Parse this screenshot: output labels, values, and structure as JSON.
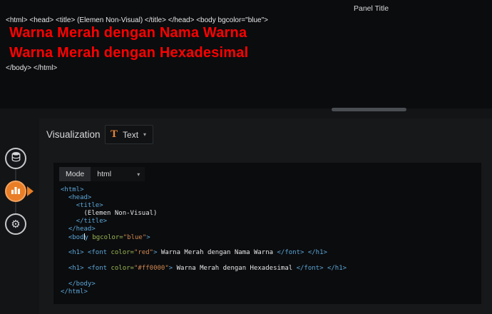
{
  "preview": {
    "panel_title": "Panel Title",
    "raw_top": "<html> <head> <title> (Elemen Non-Visual) </title> </head> <body bgcolor=\"blue\">",
    "heading1": "Warna Merah dengan Nama Warna",
    "heading2": "Warna Merah dengan Hexadesimal",
    "raw_bottom": "</body> </html>",
    "heading_color": "#ff0000"
  },
  "icons": {
    "viz_type_glyph": "T",
    "chevron": "▾",
    "gear": "⚙"
  },
  "rail": {
    "items": [
      {
        "label": "queries",
        "icon": "database-icon",
        "active": false
      },
      {
        "label": "visualization",
        "icon": "chart-icon",
        "active": true
      },
      {
        "label": "general",
        "icon": "gear-icon",
        "active": false
      }
    ]
  },
  "editor": {
    "section_label": "Visualization",
    "viz_type": "Text",
    "mode_label": "Mode",
    "mode_value": "html",
    "colors": {
      "tag": "#5ca7d8",
      "attr": "#9cb853",
      "str": "#d08850",
      "text": "#e6e6e6"
    },
    "code_lines": [
      [
        [
          "tag",
          "<html>"
        ]
      ],
      [
        [
          "text",
          "  "
        ],
        [
          "tag",
          "<head>"
        ]
      ],
      [
        [
          "text",
          "    "
        ],
        [
          "tag",
          "<title>"
        ]
      ],
      [
        [
          "text",
          "      (Elemen Non-Visual)"
        ]
      ],
      [
        [
          "text",
          "    "
        ],
        [
          "tag",
          "</title>"
        ]
      ],
      [
        [
          "text",
          "  "
        ],
        [
          "tag",
          "</head>"
        ]
      ],
      [
        [
          "text",
          "  "
        ],
        [
          "tag",
          "<bod"
        ],
        [
          "cursor",
          ""
        ],
        [
          "tag",
          "y "
        ],
        [
          "attr",
          "bgcolor="
        ],
        [
          "str",
          "\"blue\""
        ],
        [
          "tag",
          ">"
        ]
      ],
      [],
      [
        [
          "text",
          "  "
        ],
        [
          "tag",
          "<h1>"
        ],
        [
          "text",
          " "
        ],
        [
          "tag",
          "<font "
        ],
        [
          "attr",
          "color="
        ],
        [
          "str",
          "\"red\""
        ],
        [
          "tag",
          ">"
        ],
        [
          "text",
          " Warna Merah dengan Nama Warna "
        ],
        [
          "tag",
          "</font>"
        ],
        [
          "text",
          " "
        ],
        [
          "tag",
          "</h1>"
        ]
      ],
      [],
      [
        [
          "text",
          "  "
        ],
        [
          "tag",
          "<h1>"
        ],
        [
          "text",
          " "
        ],
        [
          "tag",
          "<font "
        ],
        [
          "attr",
          "color="
        ],
        [
          "str",
          "\"#ff0000\""
        ],
        [
          "tag",
          ">"
        ],
        [
          "text",
          " Warna Merah dengan Hexadesimal "
        ],
        [
          "tag",
          "</font>"
        ],
        [
          "text",
          " "
        ],
        [
          "tag",
          "</h1>"
        ]
      ],
      [],
      [
        [
          "text",
          "  "
        ],
        [
          "tag",
          "</body>"
        ]
      ],
      [
        [
          "tag",
          "</html>"
        ]
      ]
    ]
  }
}
